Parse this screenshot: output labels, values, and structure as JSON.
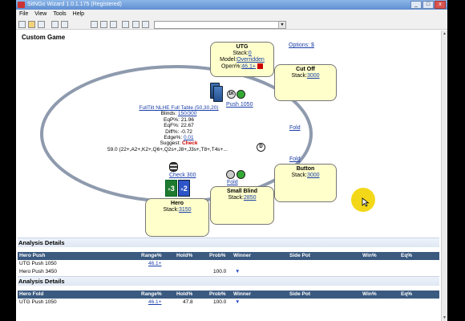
{
  "app": {
    "title": "SitNGo Wizard 1.0.1.175 (Registered)"
  },
  "window_buttons": {
    "minimize": "_",
    "maximize": "□",
    "close": "x"
  },
  "menu": [
    "File",
    "View",
    "Tools",
    "Help"
  ],
  "toolbar": {
    "icons": [
      "new-file-icon",
      "open-folder-icon",
      "save-icon",
      "print-icon",
      "copy-icon",
      "paste-icon",
      "hand-history-icon",
      "image-icon",
      "chart-icon",
      "check-icon",
      "edit-icon"
    ],
    "combo_value": ""
  },
  "game": {
    "title": "Custom Game",
    "options_link": "Options: $",
    "table_link": "FullTilt NLHE Full Table (50,30,20)",
    "blinds_label": "Blinds:",
    "blinds_value": "150/300",
    "eqp_line": "EqP%: 21.96",
    "eqf_line": "EqF%: 22.67",
    "diff_line": "Diff%: -0.72",
    "edge_label": "Edge%:",
    "edge_value": "0.01",
    "suggest_label": "Suggest:",
    "suggest_value": "Check",
    "range_line": "59.0 (22+,A2+,K2+,Q6+,Q2s+,J8+,J3s+,T8+,T4s+...",
    "dealer_button": "D",
    "colors": {
      "felt_rim": "#8e9aad",
      "seat_bg": "#ffffcc",
      "suggest": "#cc0000",
      "grid_header": "#3b5a80",
      "link": "#1a3ea8",
      "cursor": "#f2d400"
    }
  },
  "seats": {
    "utg": {
      "name": "UTG",
      "stack_label": "Stack:",
      "stack_value": "0",
      "model_label": "Model:",
      "model_value": "Overridden",
      "open_label": "Open%:",
      "open_value": "46.1+"
    },
    "cutoff": {
      "name": "Cut Off",
      "stack_label": "Stack:",
      "stack_value": "3000"
    },
    "button": {
      "name": "Button",
      "stack_label": "Stack:",
      "stack_value": "3000"
    },
    "small_blind": {
      "name": "Small Blind",
      "stack_label": "Stack:",
      "stack_value": "2850"
    },
    "hero": {
      "name": "Hero",
      "stack_label": "Stack:",
      "stack_value": "3150"
    }
  },
  "actions": {
    "utg_push": "Push 1050",
    "utg_chip": "1K",
    "cutoff_fold": "Fold",
    "button_fold": "Fold",
    "sb_fold": "Fold",
    "hero_check": "Check 300",
    "hero_cards": [
      "3",
      "2"
    ],
    "hero_card_suits": [
      "+",
      "+"
    ]
  },
  "analysis": [
    {
      "title": "Analysis Details",
      "headers": [
        "Hero Push",
        "Range%",
        "Hold%",
        "Prob%",
        "Winner",
        "Side Pot",
        "Win%",
        "Eq%"
      ],
      "rows": [
        {
          "name": "UTG Push 1050",
          "range": "46.1+",
          "hold": "",
          "prob": "",
          "winner": "",
          "side_pot": "",
          "win": "",
          "eq": ""
        },
        {
          "name": "Hero Push 3450",
          "range": "",
          "hold": "",
          "prob": "100.0",
          "winner": "▼",
          "side_pot": "",
          "win": "",
          "eq": ""
        }
      ]
    },
    {
      "title": "Analysis Details",
      "headers": [
        "Hero Fold",
        "Range%",
        "Hold%",
        "Prob%",
        "Winner",
        "Side Pot",
        "Win%",
        "Eq%"
      ],
      "rows": [
        {
          "name": "UTG Push 1050",
          "range": "46.1+",
          "hold": "47.8",
          "prob": "100.0",
          "winner": "▼",
          "side_pot": "",
          "win": "",
          "eq": ""
        }
      ]
    }
  ]
}
